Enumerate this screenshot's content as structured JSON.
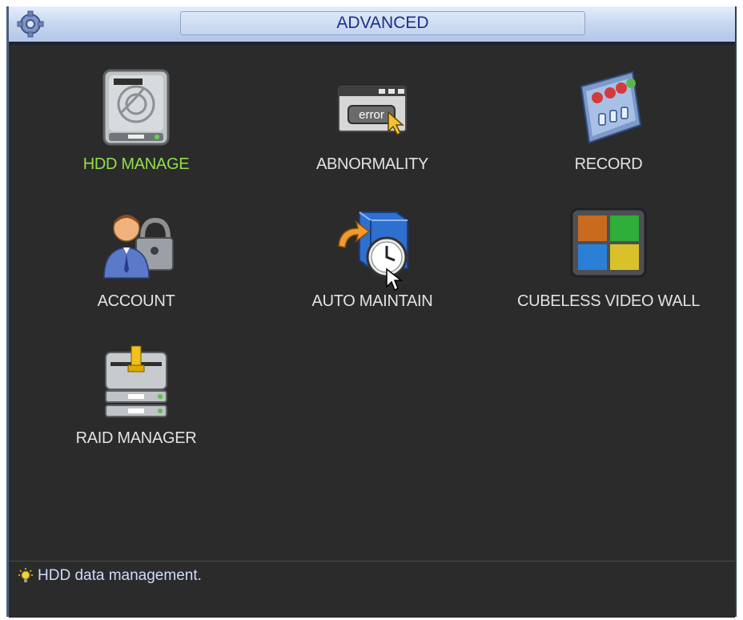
{
  "window": {
    "title": "ADVANCED",
    "title_icon": "gear-icon",
    "title_color": "#1a2f8a"
  },
  "menu": {
    "items": [
      {
        "label": "HDD MANAGE",
        "icon": "hdd-icon",
        "selected": true
      },
      {
        "label": "ABNORMALITY",
        "icon": "error-window-icon",
        "selected": false
      },
      {
        "label": "RECORD",
        "icon": "record-icon",
        "selected": false
      },
      {
        "label": "ACCOUNT",
        "icon": "account-lock-icon",
        "selected": false
      },
      {
        "label": "AUTO MAINTAIN",
        "icon": "auto-maintain-clock-icon",
        "selected": false
      },
      {
        "label": "CUBELESS VIDEO WALL",
        "icon": "video-wall-icon",
        "selected": false
      },
      {
        "label": "RAID MANAGER",
        "icon": "raid-icon",
        "selected": false
      }
    ],
    "selected_color": "#8fe04c",
    "label_color": "#e3e3e3"
  },
  "status": {
    "hint_icon": "lightbulb-icon",
    "hint_text": "HDD data management."
  }
}
